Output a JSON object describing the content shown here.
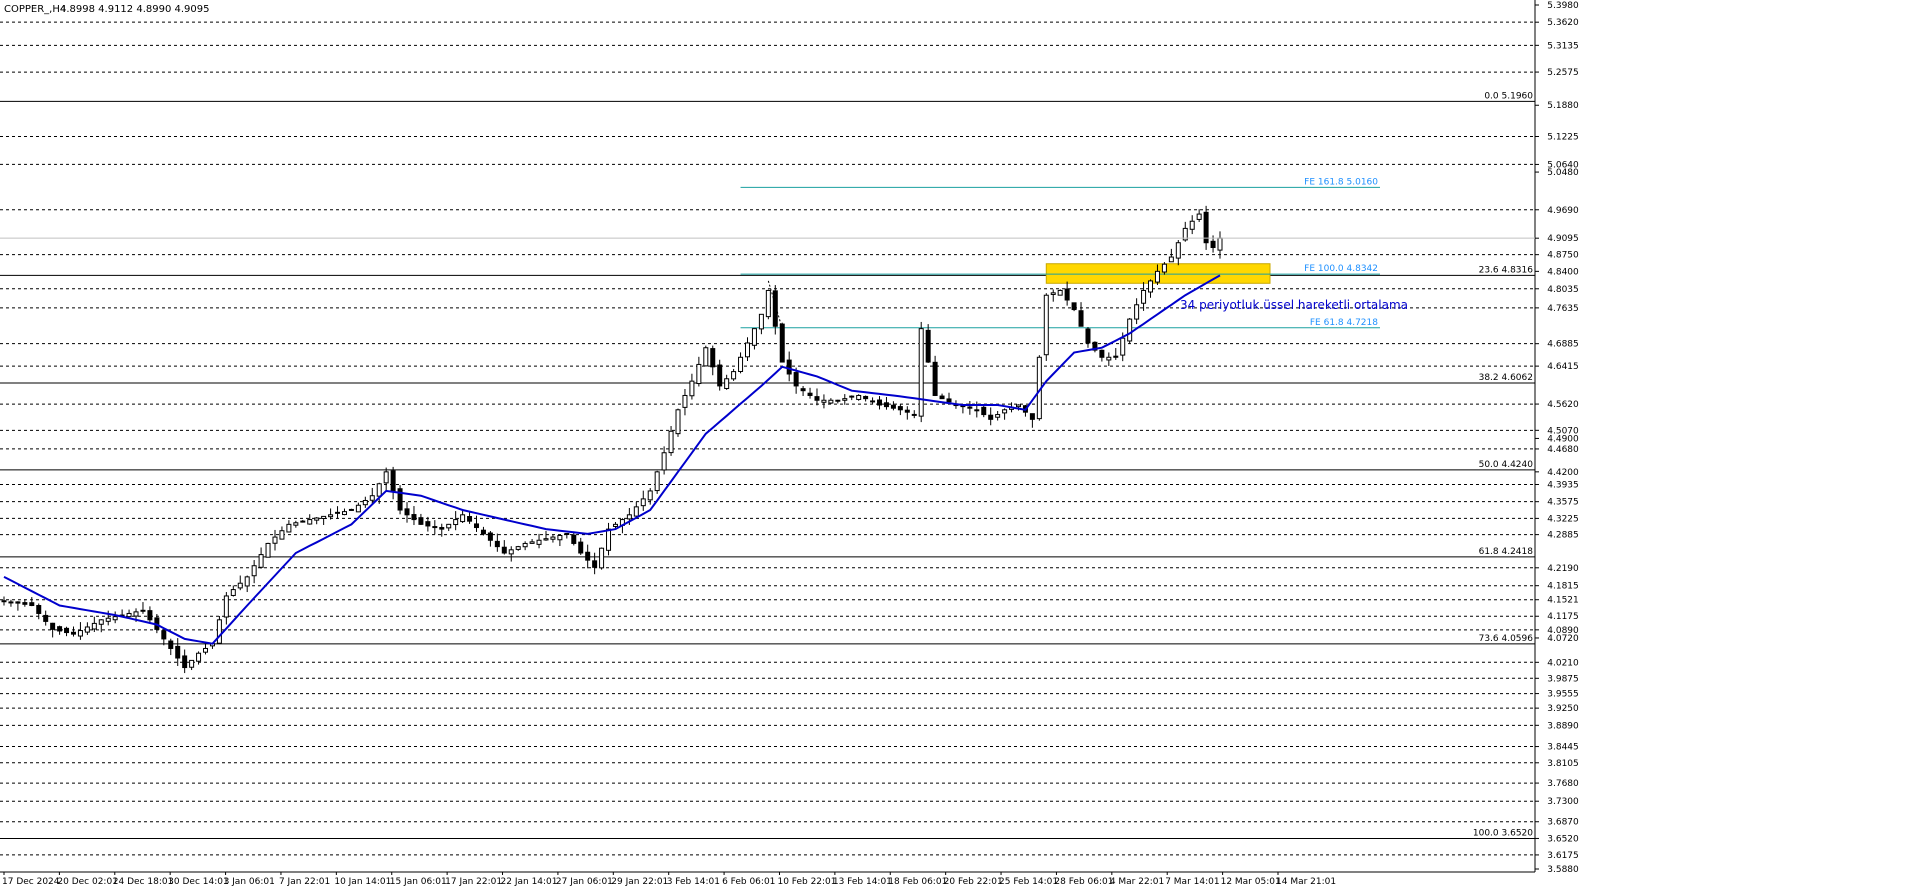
{
  "header": {
    "symbol": "COPPER_,H4",
    "ohlc": "4.8998 4.9112 4.8990 4.9095"
  },
  "chart_data": {
    "type": "candlestick",
    "symbol": "COPPER_",
    "timeframe": "H4",
    "ylim": [
      3.588,
      5.398
    ],
    "current_price": 4.9095,
    "x_ticks": [
      "17 Dec 2024",
      "20 Dec 02:01",
      "24 Dec 18:01",
      "30 Dec 14:01",
      "3 Jan 06:01",
      "7 Jan 22:01",
      "10 Jan 14:01",
      "15 Jan 06:01",
      "17 Jan 22:01",
      "22 Jan 14:01",
      "27 Jan 06:01",
      "29 Jan 22:01",
      "3 Feb 14:01",
      "6 Feb 06:01",
      "10 Feb 22:01",
      "13 Feb 14:01",
      "18 Feb 06:01",
      "20 Feb 22:01",
      "25 Feb 14:01",
      "28 Feb 06:01",
      "4 Mar 22:01",
      "7 Mar 14:01",
      "12 Mar 05:01",
      "14 Mar 21:01"
    ],
    "price_axis_labels": [
      "5.3980",
      "5.3620",
      "5.3135",
      "5.2575",
      "5.1880",
      "5.1225",
      "5.0640",
      "5.0480",
      "4.9690",
      "4.9095",
      "4.8750",
      "4.8400",
      "4.8035",
      "4.7635",
      "4.6885",
      "4.6415",
      "4.5620",
      "4.5070",
      "4.4900",
      "4.4680",
      "4.4200",
      "4.3935",
      "4.3575",
      "4.3225",
      "4.2885",
      "4.2190",
      "4.1815",
      "4.1521",
      "4.1175",
      "4.0890",
      "4.0720",
      "4.0210",
      "3.9875",
      "3.9555",
      "3.9250",
      "3.8890",
      "3.8445",
      "3.8105",
      "3.7680",
      "3.7300",
      "3.6870",
      "3.6520",
      "3.6175",
      "3.5880"
    ],
    "dashed_levels": [
      5.362,
      5.3135,
      5.2575,
      5.1225,
      5.064,
      4.969,
      4.875,
      4.8035,
      4.7635,
      4.6885,
      4.6415,
      4.562,
      4.507,
      4.468,
      4.3935,
      4.3575,
      4.3225,
      4.2885,
      4.219,
      4.1815,
      4.1521,
      4.1175,
      4.089,
      4.021,
      3.9875,
      3.9555,
      3.925,
      3.889,
      3.8445,
      3.8105,
      3.768,
      3.73,
      3.687,
      3.6175
    ],
    "fibonacci_retracement": [
      {
        "label": "0.0",
        "value": 5.196
      },
      {
        "label": "23.6",
        "value": 4.8316
      },
      {
        "label": "38.2",
        "value": 4.6062
      },
      {
        "label": "50.0",
        "value": 4.424
      },
      {
        "label": "61.8",
        "value": 4.2418
      },
      {
        "label": "73.6",
        "value": 4.0596
      },
      {
        "label": "100.0",
        "value": 3.652
      }
    ],
    "fibonacci_expansion": [
      {
        "label": "FE 161.8",
        "value": 5.016
      },
      {
        "label": "FE 100.0",
        "value": 4.8342
      },
      {
        "label": "FE 61.8",
        "value": 4.7218
      }
    ],
    "resistance_zone": {
      "from": 4.815,
      "to": 4.856,
      "color": "#ffd700"
    },
    "ema_label": "34 periyotluk üssel hareketli ortalama",
    "ema_color": "#0000cc",
    "close_path": [
      [
        0,
        4.15
      ],
      [
        4,
        4.14
      ],
      [
        7,
        4.09
      ],
      [
        10,
        4.08
      ],
      [
        14,
        4.11
      ],
      [
        17,
        4.12
      ],
      [
        20,
        4.13
      ],
      [
        23,
        4.07
      ],
      [
        26,
        4.01
      ],
      [
        28,
        4.04
      ],
      [
        30,
        4.06
      ],
      [
        32,
        4.16
      ],
      [
        35,
        4.2
      ],
      [
        38,
        4.27
      ],
      [
        41,
        4.31
      ],
      [
        44,
        4.32
      ],
      [
        47,
        4.33
      ],
      [
        50,
        4.34
      ],
      [
        53,
        4.37
      ],
      [
        55,
        4.42
      ],
      [
        57,
        4.34
      ],
      [
        60,
        4.31
      ],
      [
        63,
        4.3
      ],
      [
        66,
        4.33
      ],
      [
        69,
        4.29
      ],
      [
        72,
        4.25
      ],
      [
        75,
        4.27
      ],
      [
        78,
        4.28
      ],
      [
        81,
        4.29
      ],
      [
        83,
        4.25
      ],
      [
        85,
        4.22
      ],
      [
        87,
        4.3
      ],
      [
        90,
        4.33
      ],
      [
        93,
        4.38
      ],
      [
        95,
        4.46
      ],
      [
        97,
        4.55
      ],
      [
        99,
        4.61
      ],
      [
        101,
        4.68
      ],
      [
        103,
        4.6
      ],
      [
        105,
        4.63
      ],
      [
        107,
        4.69
      ],
      [
        109,
        4.75
      ],
      [
        110,
        4.8
      ],
      [
        112,
        4.65
      ],
      [
        114,
        4.6
      ],
      [
        117,
        4.57
      ],
      [
        120,
        4.57
      ],
      [
        123,
        4.58
      ],
      [
        126,
        4.56
      ],
      [
        129,
        4.55
      ],
      [
        131,
        4.54
      ],
      [
        132,
        4.72
      ],
      [
        134,
        4.58
      ],
      [
        137,
        4.56
      ],
      [
        140,
        4.55
      ],
      [
        142,
        4.53
      ],
      [
        144,
        4.55
      ],
      [
        146,
        4.56
      ],
      [
        148,
        4.53
      ],
      [
        150,
        4.79
      ],
      [
        152,
        4.8
      ],
      [
        154,
        4.76
      ],
      [
        156,
        4.69
      ],
      [
        158,
        4.66
      ],
      [
        160,
        4.66
      ],
      [
        162,
        4.74
      ],
      [
        164,
        4.8
      ],
      [
        166,
        4.84
      ],
      [
        168,
        4.87
      ],
      [
        170,
        4.93
      ],
      [
        172,
        4.96
      ],
      [
        173,
        4.9
      ],
      [
        174,
        4.89
      ],
      [
        175,
        4.9095
      ]
    ],
    "ema_path": [
      [
        0,
        4.2
      ],
      [
        8,
        4.14
      ],
      [
        16,
        4.12
      ],
      [
        22,
        4.1
      ],
      [
        26,
        4.07
      ],
      [
        30,
        4.06
      ],
      [
        35,
        4.14
      ],
      [
        42,
        4.25
      ],
      [
        50,
        4.31
      ],
      [
        55,
        4.38
      ],
      [
        60,
        4.37
      ],
      [
        66,
        4.34
      ],
      [
        72,
        4.32
      ],
      [
        78,
        4.3
      ],
      [
        84,
        4.29
      ],
      [
        88,
        4.3
      ],
      [
        93,
        4.34
      ],
      [
        97,
        4.42
      ],
      [
        101,
        4.5
      ],
      [
        105,
        4.55
      ],
      [
        109,
        4.6
      ],
      [
        112,
        4.64
      ],
      [
        117,
        4.62
      ],
      [
        122,
        4.59
      ],
      [
        128,
        4.58
      ],
      [
        133,
        4.57
      ],
      [
        138,
        4.56
      ],
      [
        143,
        4.56
      ],
      [
        147,
        4.55
      ],
      [
        150,
        4.61
      ],
      [
        154,
        4.67
      ],
      [
        158,
        4.68
      ],
      [
        162,
        4.71
      ],
      [
        166,
        4.75
      ],
      [
        170,
        4.79
      ],
      [
        175,
        4.8316
      ]
    ]
  }
}
